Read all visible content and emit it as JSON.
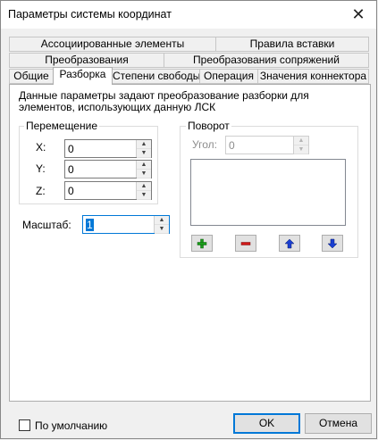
{
  "window": {
    "title": "Параметры системы координат",
    "close_glyph": "✕"
  },
  "tabs": {
    "row1": [
      "Ассоциированные элементы",
      "Правила вставки"
    ],
    "row2": [
      "Преобразования",
      "Преобразования сопряжений"
    ],
    "row3": [
      "Общие",
      "Разборка",
      "Степени свободы",
      "Операция",
      "Значения коннектора"
    ],
    "active": "Разборка"
  },
  "description": "Данные параметры задают преобразование разборки для элементов, использующих данную ЛСК",
  "move_group": {
    "title": "Перемещение",
    "x_label": "X:",
    "x_value": "0",
    "y_label": "Y:",
    "y_value": "0",
    "z_label": "Z:",
    "z_value": "0"
  },
  "scale": {
    "label": "Масштаб:",
    "value": "1"
  },
  "rotation_group": {
    "title": "Поворот",
    "angle_label": "Угол:",
    "angle_value": "0",
    "add_icon": "plus-icon",
    "remove_icon": "minus-icon",
    "up_icon": "arrow-up-icon",
    "down_icon": "arrow-down-icon",
    "colors": {
      "add": "#1a9c1a",
      "remove": "#d11a1a",
      "move": "#1a3fd1"
    }
  },
  "footer": {
    "default_checkbox_label": "По умолчанию",
    "ok_label": "OK",
    "cancel_label": "Отмена"
  }
}
